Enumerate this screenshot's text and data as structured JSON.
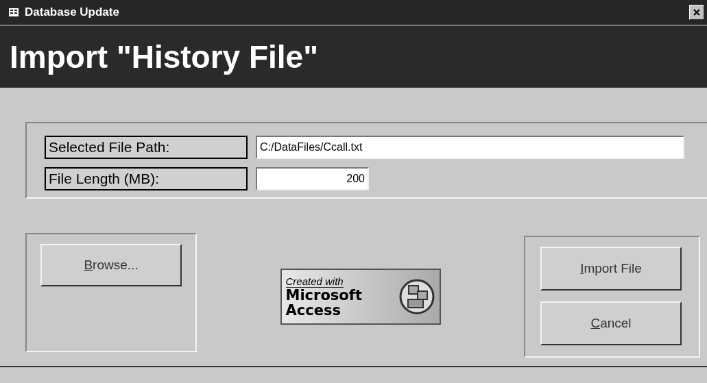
{
  "window": {
    "title": "Database Update"
  },
  "header": {
    "title": "Import \"History File\""
  },
  "fields": [
    {
      "label": "Selected File Path:",
      "value": "C:/DataFiles/Ccall.txt",
      "kind": "wide"
    },
    {
      "label": "File Length (MB):",
      "value": "200",
      "kind": "number"
    }
  ],
  "left_buttons": [
    "Browse..."
  ],
  "badge": {
    "caption": "Created with",
    "line1": "Microsoft",
    "line2": "Access"
  },
  "right_buttons": [
    "Import File",
    "Cancel"
  ]
}
